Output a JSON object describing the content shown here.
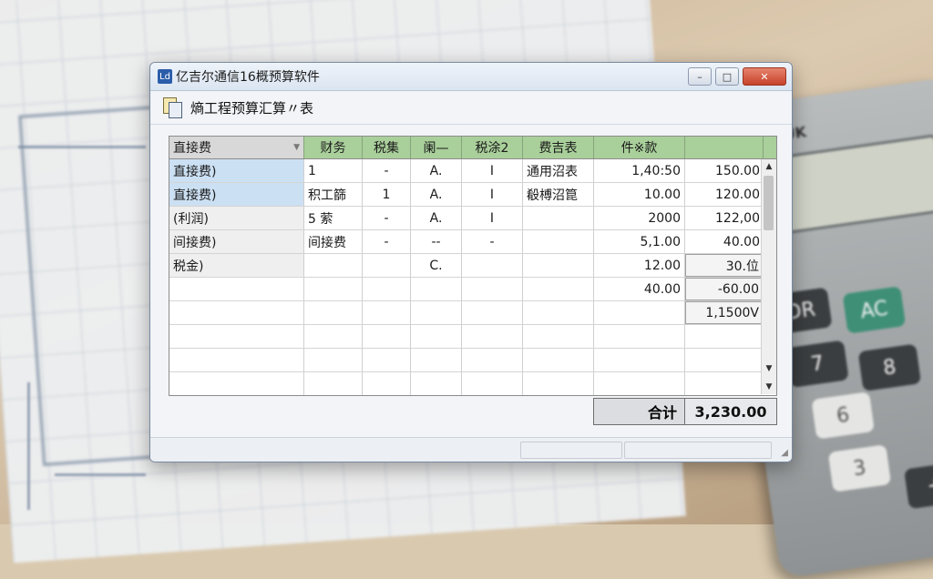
{
  "window": {
    "title": "亿吉尔通信16概预算软件",
    "icon_text": "Ld",
    "controls": {
      "minimize": "–",
      "maximize": "□",
      "close": "✕"
    }
  },
  "toolbar": {
    "title": "熵工程预算汇算〃表",
    "icon": "document-icon"
  },
  "table": {
    "headers": [
      "直接费",
      "财务",
      "税集",
      "阑—",
      "税涂2",
      "费吉表",
      "件※款",
      ""
    ],
    "rows": [
      [
        "直接费)",
        "1",
        "-",
        "A.",
        "I",
        "通用沼表",
        "1,40:50",
        "150.00"
      ],
      [
        "直接费)",
        "积工篩",
        "1",
        "A.",
        "I",
        "殽榑沼箟",
        "10.00",
        "120.00"
      ],
      [
        "(利润)",
        "5 萦",
        "-",
        "A.",
        "I",
        "",
        "2000",
        "122,00"
      ],
      [
        "间接费)",
        "间接费",
        "-",
        "--",
        "-",
        "",
        "5,1.00",
        "40.00"
      ],
      [
        "税金)",
        "",
        "",
        "C.",
        "",
        "",
        "12.00",
        "30.位"
      ],
      [
        "",
        "",
        "",
        "",
        "",
        "",
        "40.00",
        "-60.00"
      ],
      [
        "",
        "",
        "",
        "",
        "",
        "",
        "",
        "1,1500V"
      ],
      [
        "",
        "",
        "",
        "",
        "",
        "",
        "",
        ""
      ],
      [
        "",
        "",
        "",
        "",
        "",
        "",
        "",
        ""
      ],
      [
        "",
        "",
        "",
        "",
        "",
        "",
        "",
        ""
      ]
    ]
  },
  "total": {
    "label": "合计",
    "value": "3,230.00"
  },
  "colors": {
    "header_green": "#a9cf9a",
    "selected_cell": "#cce0f3",
    "close_button": "#c6422a"
  },
  "calculator": {
    "brand": "UK",
    "keys": [
      "DR",
      "AC",
      "7",
      "8",
      "6",
      "3",
      "+"
    ]
  }
}
